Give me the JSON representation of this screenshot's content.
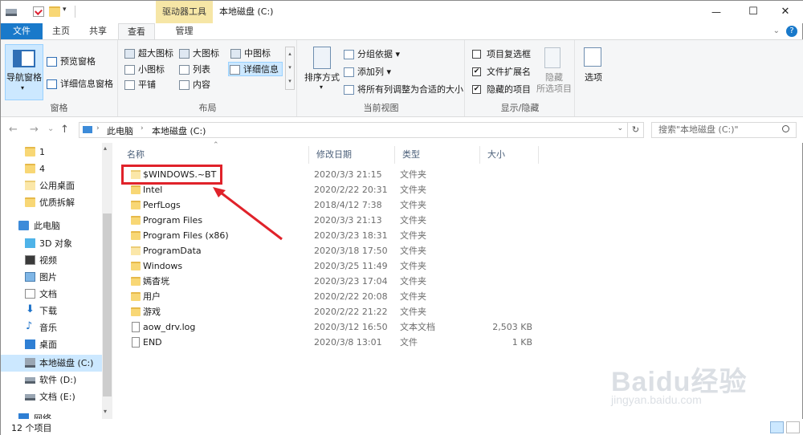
{
  "title_bar": {
    "contextual_tab_header": "驱动器工具",
    "window_title": "本地磁盘 (C:)",
    "minimize": "—",
    "maximize": "☐",
    "close": "✕"
  },
  "ribbon_tabs": {
    "file": "文件",
    "home": "主页",
    "share": "共享",
    "view": "查看",
    "manage": "管理",
    "collapse": "⌄",
    "help": "?"
  },
  "ribbon": {
    "panes": {
      "label": "窗格",
      "navigation_pane": "导航窗格",
      "preview_pane": "预览窗格",
      "details_pane": "详细信息窗格"
    },
    "layout": {
      "label": "布局",
      "items": [
        "超大图标",
        "大图标",
        "中图标",
        "小图标",
        "列表",
        "详细信息",
        "平铺",
        "内容"
      ]
    },
    "current_view": {
      "label": "当前视图",
      "sort_by": "排序方式",
      "group_by": "分组依据",
      "add_columns": "添加列",
      "size_all_columns": "将所有列调整为合适的大小"
    },
    "show_hide": {
      "label": "显示/隐藏",
      "item_checkboxes": "项目复选框",
      "item_checkboxes_checked": false,
      "file_extensions": "文件扩展名",
      "file_extensions_checked": true,
      "hidden_items": "隐藏的项目",
      "hidden_items_checked": true,
      "hide_selected": "隐藏\n所选项目"
    },
    "options": "选项"
  },
  "address": {
    "back": "←",
    "forward": "→",
    "recent": "⌄",
    "up": "↑",
    "crumbs": [
      "此电脑",
      "本地磁盘 (C:)"
    ],
    "refresh": "↻",
    "search_placeholder": "搜索\"本地磁盘 (C:)\""
  },
  "nav_pane": {
    "items": [
      {
        "label": "1",
        "icon": "folder-icon"
      },
      {
        "label": "4",
        "icon": "folder-icon"
      },
      {
        "label": "公用桌面",
        "icon": "folder-icon"
      },
      {
        "label": "优质拆解",
        "icon": "folder-icon"
      },
      {
        "label": "此电脑",
        "icon": "computer-icon"
      },
      {
        "label": "3D 对象",
        "icon": "cube-icon"
      },
      {
        "label": "视频",
        "icon": "video-icon"
      },
      {
        "label": "图片",
        "icon": "picture-icon"
      },
      {
        "label": "文档",
        "icon": "document-icon"
      },
      {
        "label": "下载",
        "icon": "download-icon"
      },
      {
        "label": "音乐",
        "icon": "music-icon"
      },
      {
        "label": "桌面",
        "icon": "desktop-icon"
      },
      {
        "label": "本地磁盘 (C:)",
        "icon": "drive-icon"
      },
      {
        "label": "软件 (D:)",
        "icon": "drive-icon"
      },
      {
        "label": "文档 (E:)",
        "icon": "drive-icon"
      },
      {
        "label": "网络",
        "icon": "network-icon"
      }
    ]
  },
  "columns": {
    "name": "名称",
    "date": "修改日期",
    "type": "类型",
    "size": "大小"
  },
  "files": [
    {
      "name": "$WINDOWS.~BT",
      "date": "2020/3/3 21:15",
      "type": "文件夹",
      "size": "",
      "icon": "folder-icon"
    },
    {
      "name": "Intel",
      "date": "2020/2/22 20:31",
      "type": "文件夹",
      "size": "",
      "icon": "folder-icon"
    },
    {
      "name": "PerfLogs",
      "date": "2018/4/12 7:38",
      "type": "文件夹",
      "size": "",
      "icon": "folder-icon"
    },
    {
      "name": "Program Files",
      "date": "2020/3/3 21:13",
      "type": "文件夹",
      "size": "",
      "icon": "folder-icon"
    },
    {
      "name": "Program Files (x86)",
      "date": "2020/3/23 18:31",
      "type": "文件夹",
      "size": "",
      "icon": "folder-icon"
    },
    {
      "name": "ProgramData",
      "date": "2020/3/18 17:50",
      "type": "文件夹",
      "size": "",
      "icon": "folder-icon"
    },
    {
      "name": "Windows",
      "date": "2020/3/25 11:49",
      "type": "文件夹",
      "size": "",
      "icon": "folder-icon"
    },
    {
      "name": "嫣杳垙",
      "date": "2020/3/23 17:04",
      "type": "文件夹",
      "size": "",
      "icon": "folder-icon"
    },
    {
      "name": "用户",
      "date": "2020/2/22 20:08",
      "type": "文件夹",
      "size": "",
      "icon": "folder-icon"
    },
    {
      "name": "游戏",
      "date": "2020/2/22 21:22",
      "type": "文件夹",
      "size": "",
      "icon": "folder-icon"
    },
    {
      "name": "aow_drv.log",
      "date": "2020/3/12 16:50",
      "type": "文本文档",
      "size": "2,503 KB",
      "icon": "text-file-icon"
    },
    {
      "name": "END",
      "date": "2020/3/8 13:01",
      "type": "文件",
      "size": "1 KB",
      "icon": "file-icon"
    }
  ],
  "status": {
    "item_count": "12 个项目"
  },
  "watermark": {
    "brand": "Baidu经验",
    "url": "jingyan.baidu.com"
  },
  "colors": {
    "file_tab": "#1979ca",
    "contextual_tab": "#f6e6a6",
    "annotation_red": "#e0222a",
    "selection": "#cce8ff"
  }
}
